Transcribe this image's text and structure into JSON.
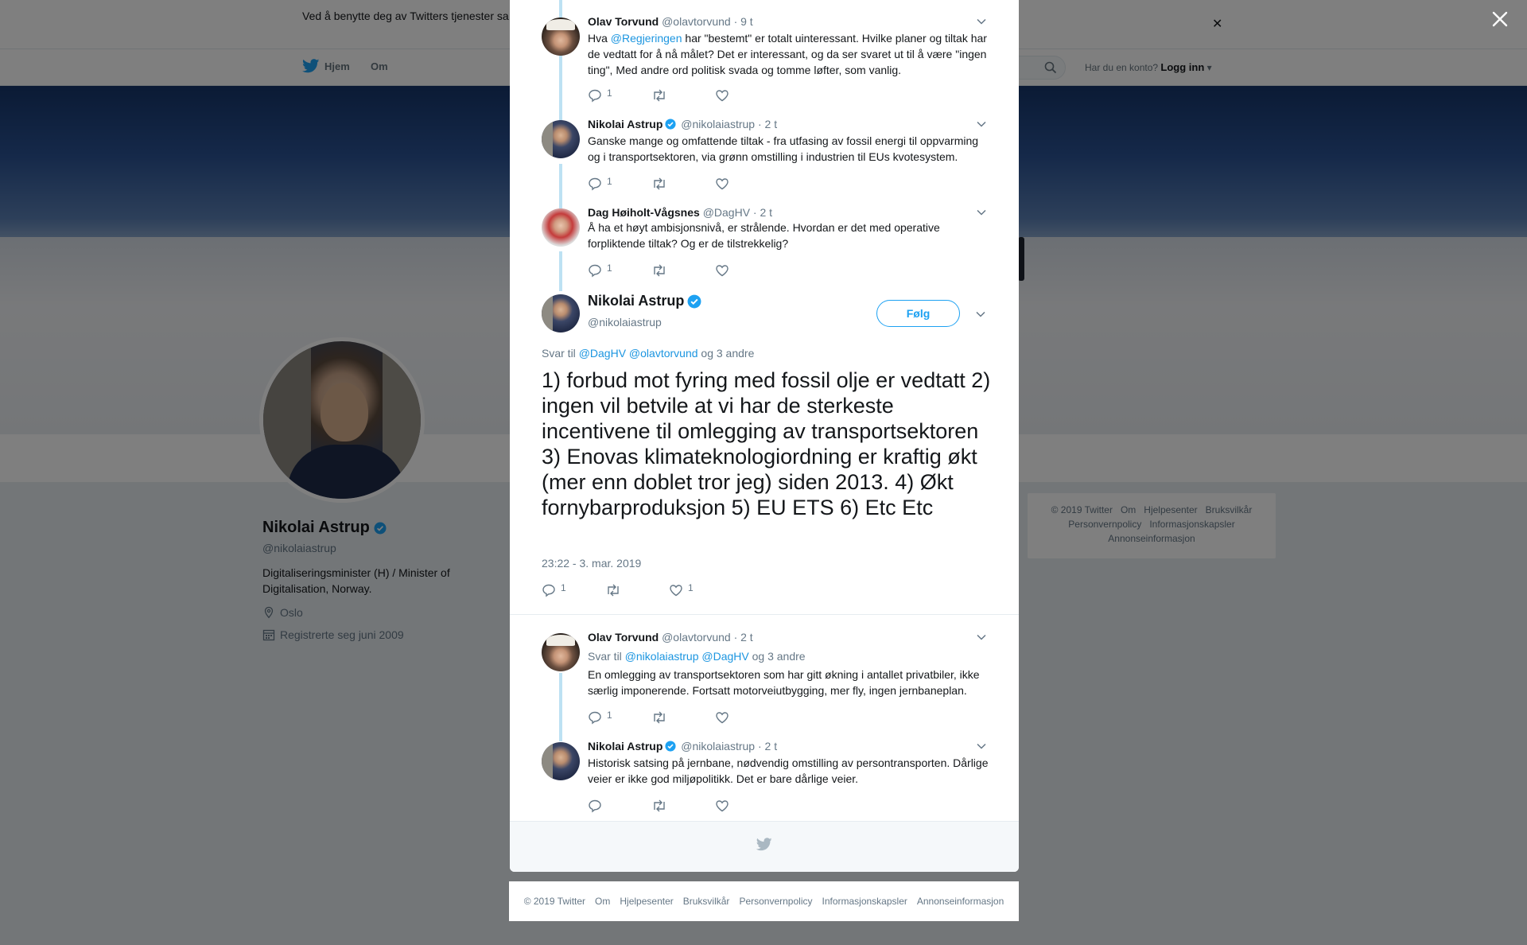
{
  "cookie_bar": {
    "text": "Ved å benytte deg av Twitters tjenester sa                                                                                        informasjonskapsler til bl.a. analyser, personalisering og annonser."
  },
  "nav": {
    "home_label": "Hjem",
    "about_label": "Om",
    "login_prompt": "Har du en konto?",
    "login_label": "Logg inn"
  },
  "profile": {
    "name": "Nikolai Astrup",
    "handle": "@nikolaiastrup",
    "bio": "Digitaliseringsminister (H) / Minister of Digitalisation, Norway.",
    "location": "Oslo",
    "joined": "Registrerte seg juni 2009"
  },
  "side_footer": {
    "items": [
      "© 2019 Twitter",
      "Om",
      "Hjelpesenter",
      "Bruksvilkår",
      "Personvernpolicy",
      "Informasjonskapsler",
      "Annonseinformasjon"
    ]
  },
  "thread": [
    {
      "name": "Olav Torvund",
      "handle": "@olavtorvund",
      "time": "· 9 t",
      "text_before": "Hva ",
      "mention": "@Regjeringen",
      "text_after": " har \"bestemt\" er totalt uinteressant. Hvilke planer og tiltak har de vedtatt for å nå målet? Det er interessant, og da ser svaret ut til å være \"ingen ting\", Med andre ord politisk svada og tomme løfter, som vanlig.",
      "replies": "1"
    },
    {
      "name": "Nikolai Astrup",
      "handle": "@nikolaiastrup",
      "time": "· 2 t",
      "text": "Ganske mange og omfattende tiltak - fra utfasing av fossil energi til oppvarming og i transportsektoren, via grønn omstilling i industrien til EUs kvotesystem.",
      "replies": "1"
    },
    {
      "name": "Dag Høiholt-Vågsnes",
      "handle": "@DagHV",
      "time": "· 2 t",
      "text": "Å ha et høyt ambisjonsnivå, er strålende. Hvordan er det med operative forpliktende tiltak? Og er de tilstrekkelig?",
      "replies": "1"
    }
  ],
  "main_tweet": {
    "name": "Nikolai Astrup",
    "handle": "@nikolaiastrup",
    "follow_label": "Følg",
    "reply_prefix": "Svar til",
    "reply_mention_1": "@DagHV",
    "reply_mention_2": "@olavtorvund",
    "reply_suffix": "og 3 andre",
    "text": "1) forbud mot fyring med fossil olje er vedtatt 2) ingen vil betvile at vi har de sterkeste incentivene til omlegging av transportsektoren 3) Enovas klimateknologiordning er kraftig økt (mer enn doblet tror jeg) siden 2013. 4) Økt fornybarproduksjon 5) EU ETS 6) Etc Etc",
    "timestamp": "23:22 - 3. mar. 2019",
    "replies": "1",
    "likes": "1"
  },
  "replies": [
    {
      "name": "Olav Torvund",
      "handle": "@olavtorvund",
      "time": "· 2 t",
      "reply_prefix": "Svar til",
      "reply_mention_1": "@nikolaiastrup",
      "reply_mention_2": "@DagHV",
      "reply_suffix": "og 3 andre",
      "text": "En omlegging av transportsektoren som har gitt økning i antallet privatbiler, ikke særlig imponerende. Fortsatt motorveiutbygging, mer fly, ingen jernbaneplan.",
      "replies": "1"
    },
    {
      "name": "Nikolai Astrup",
      "handle": "@nikolaiastrup",
      "time": "· 2 t",
      "text": "Historisk satsing på jernbane, nødvendig omstilling av persontransporten. Dårlige veier er ikke god miljøpolitikk. Det er bare dårlige veier."
    }
  ],
  "modal_footer": {
    "items": [
      "© 2019 Twitter",
      "Om",
      "Hjelpesenter",
      "Bruksvilkår",
      "Personvernpolicy",
      "Informasjonskapsler",
      "Annonseinformasjon"
    ]
  },
  "colors": {
    "accent": "#1da1f2",
    "link": "#1b95e0",
    "thread_line": "#bde1f3",
    "muted": "#657786"
  },
  "icons": [
    "twitter-bird-icon",
    "search-icon",
    "caret-down-icon",
    "close-icon",
    "reply-icon",
    "retweet-icon",
    "like-icon",
    "verified-badge-icon",
    "location-icon",
    "calendar-icon",
    "chevron-down-icon"
  ]
}
